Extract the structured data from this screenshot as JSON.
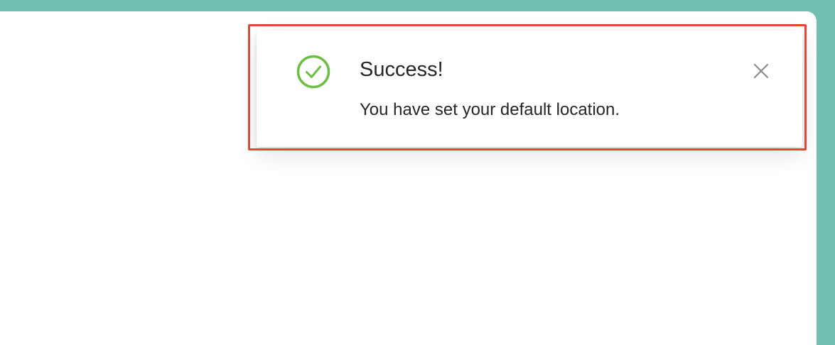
{
  "notification": {
    "status": "success",
    "icon": "check-circle-icon",
    "title": "Success!",
    "message": "You have set your default location.",
    "close_icon": "close-icon"
  },
  "colors": {
    "background_accent": "#72c0b1",
    "success": "#6ebd45",
    "highlight_border": "#e04a32",
    "text": "#262626",
    "close_icon": "#8c8c8c"
  }
}
